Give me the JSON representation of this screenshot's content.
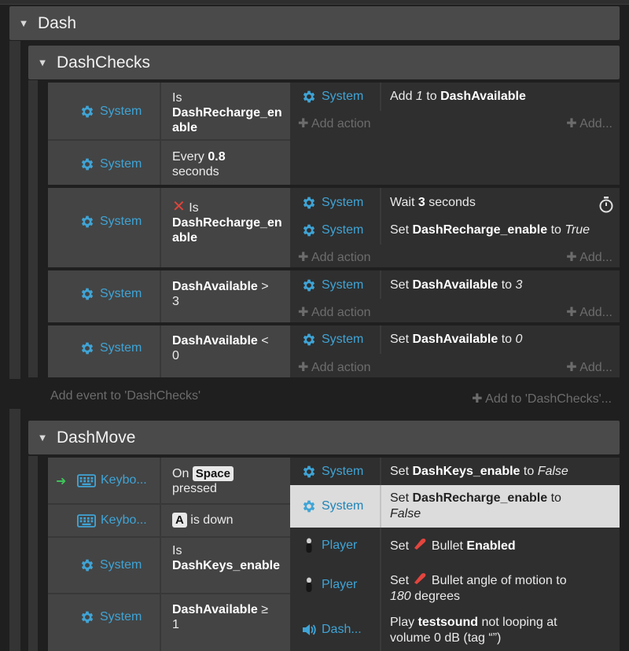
{
  "groups": {
    "dash": {
      "title": "Dash"
    },
    "dash_checks": {
      "title": "DashChecks",
      "add_event": "Add event to 'DashChecks'",
      "add_to": "Add to 'DashChecks'..."
    },
    "dash_move": {
      "title": "DashMove"
    }
  },
  "common": {
    "system": "System",
    "add_action": "Add action",
    "add_more": "Add..."
  },
  "ev1": {
    "c1_text_pre": "Is",
    "c1_text_bold": "DashRecharge_enable",
    "c2_text_pre": "Every",
    "c2_text_bold": "0.8",
    "c2_text_post": "seconds",
    "a1_pre": "Add",
    "a1_num": "1",
    "a1_mid": "to",
    "a1_bold": "DashAvailable"
  },
  "ev2": {
    "c1_text_pre": "Is",
    "c1_text_bold": "DashRecharge_enable",
    "a1_pre": "Wait",
    "a1_bold": "3",
    "a1_post": "seconds",
    "a2_pre": "Set",
    "a2_bold": "DashRecharge_enable",
    "a2_mid": "to",
    "a2_italic": "True"
  },
  "ev3": {
    "c1_bold": "DashAvailable",
    "c1_post": ">",
    "c1_num": "3",
    "a1_pre": "Set",
    "a1_bold": "DashAvailable",
    "a1_mid": "to",
    "a1_italic": "3"
  },
  "ev4": {
    "c1_bold": "DashAvailable",
    "c1_post": "<",
    "c1_num": "0",
    "a1_pre": "Set",
    "a1_bold": "DashAvailable",
    "a1_mid": "to",
    "a1_italic": "0"
  },
  "ev5": {
    "keyboard": "Keybo...",
    "c1_pre": "On",
    "c1_key": "Space",
    "c1_post": "pressed",
    "c2_key": "A",
    "c2_post": "is down",
    "c3_pre": "Is",
    "c3_bold": "DashKeys_enable",
    "c4_bold": "DashAvailable",
    "c4_post": "≥",
    "c4_num": "1",
    "player": "Player",
    "dash_audio": "Dash...",
    "a1_pre": "Set",
    "a1_bold": "DashKeys_enable",
    "a1_mid": "to",
    "a1_italic": "False",
    "a2_pre": "Set",
    "a2_bold": "DashRecharge_enable",
    "a2_mid": "to",
    "a2_italic": "False",
    "a3_pre": "Set",
    "a3_mid": "Bullet",
    "a3_bold": "Enabled",
    "a4_pre": "Set",
    "a4_mid": "Bullet angle of motion to",
    "a4_italic": "180",
    "a4_post": "degrees",
    "a5_pre": "Play",
    "a5_bold": "testsound",
    "a5_mid": "not looping at",
    "a5_post": "volume 0 dB (tag “”)"
  },
  "colors": {
    "accent_blue": "#3fa4d6",
    "green_arrow": "#3fc25a",
    "invert_red": "#e0433a",
    "bullet_red": "#e3453e"
  },
  "icons": [
    "gear-icon",
    "keyboard-icon",
    "invert-x-icon",
    "stopwatch-icon",
    "speaker-icon",
    "bullet-icon",
    "player-figure-icon",
    "trigger-arrow-icon",
    "plus-icon",
    "collapse-triangle-icon"
  ]
}
